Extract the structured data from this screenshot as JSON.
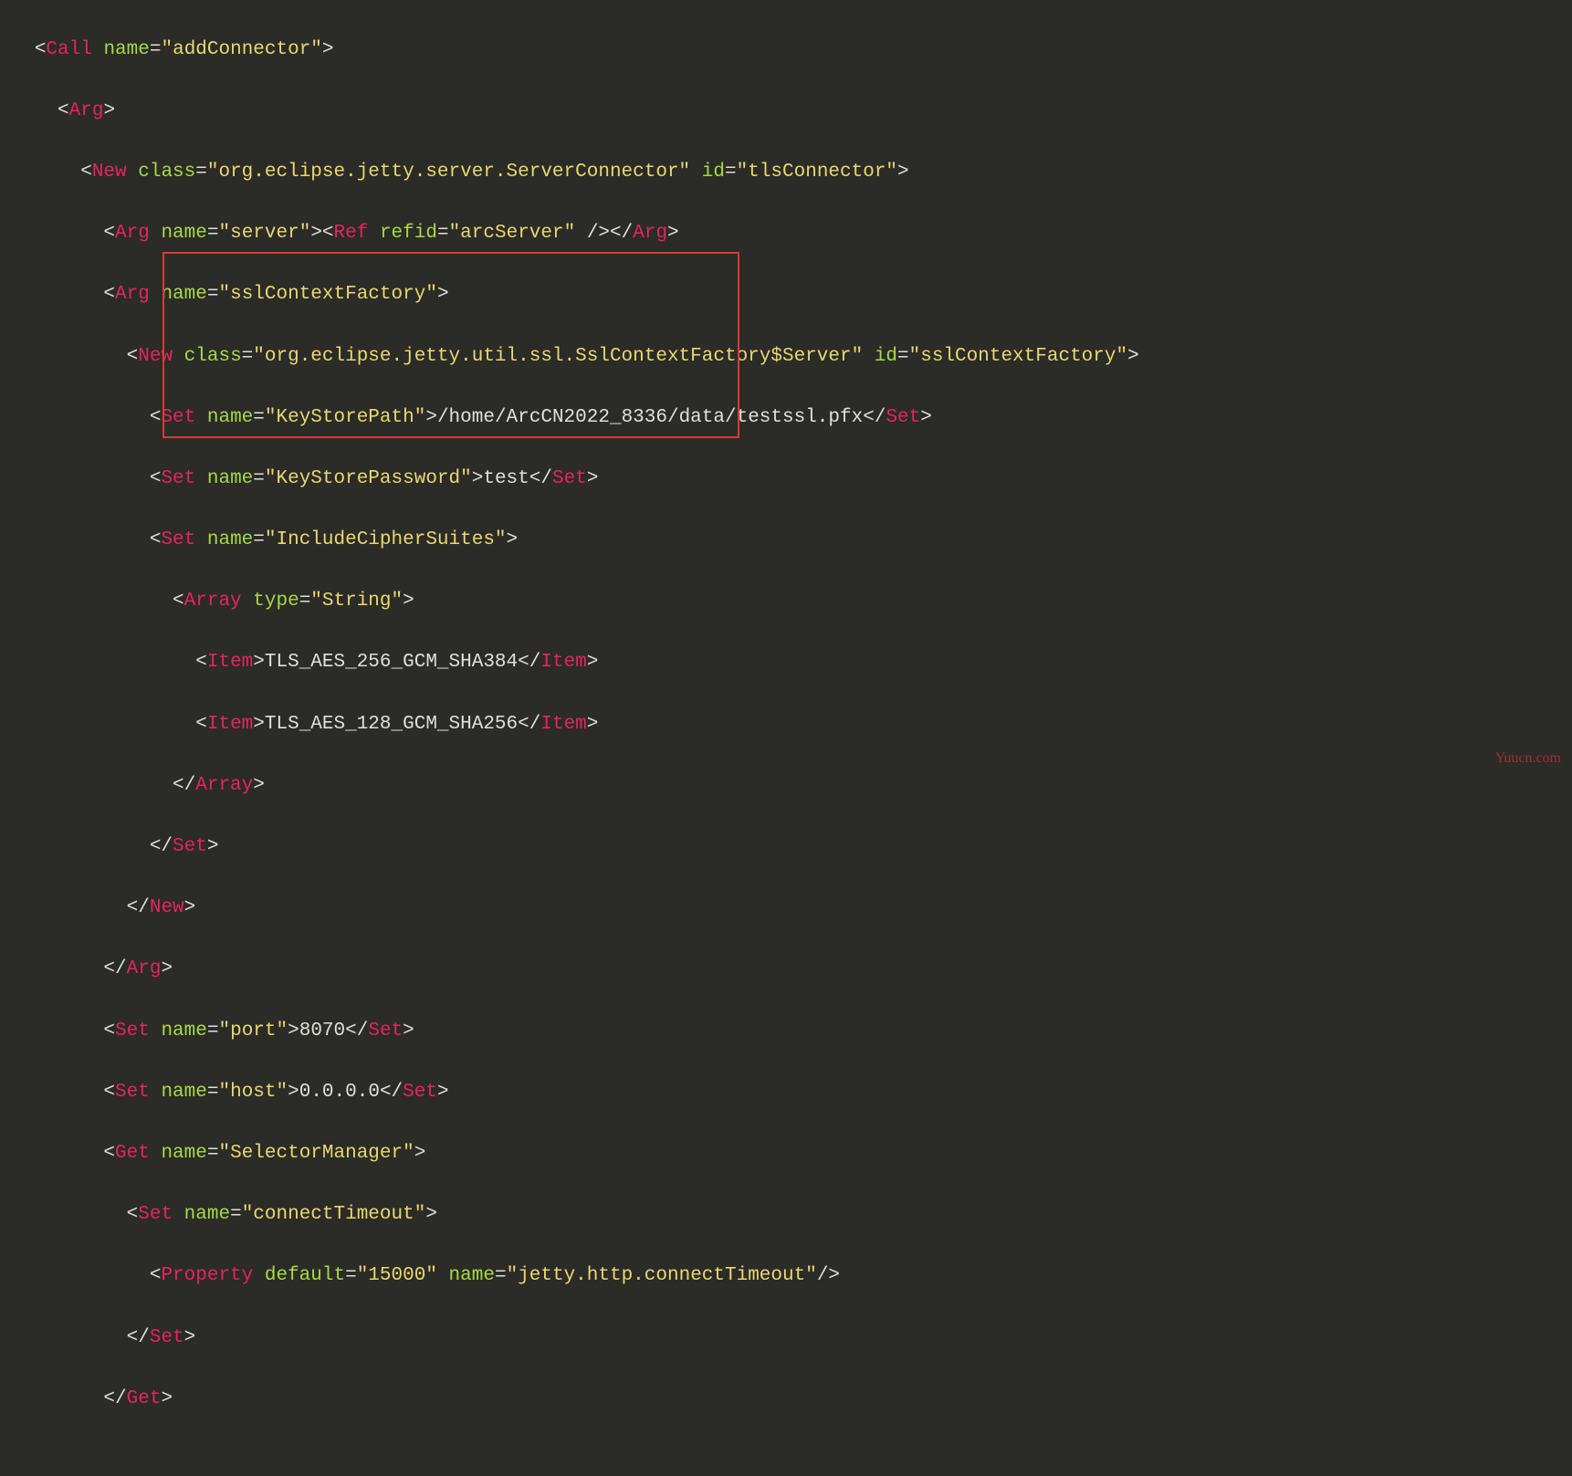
{
  "lines": {
    "l1_tag": "Call",
    "l1_attr": "name",
    "l1_val": "\"addConnector\"",
    "l2_tag": "Arg",
    "l3_tag": "New",
    "l3_a1": "class",
    "l3_v1": "\"org.eclipse.jetty.server.ServerConnector\"",
    "l3_a2": "id",
    "l3_v2": "\"tlsConnector\"",
    "l4_tag1": "Arg",
    "l4_a1": "name",
    "l4_v1": "\"server\"",
    "l4_tag2": "Ref",
    "l4_a2": "refid",
    "l4_v2": "\"arcServer\"",
    "l4_close": "Arg",
    "l5_tag": "Arg",
    "l5_a": "name",
    "l5_v": "\"sslContextFactory\"",
    "l6_tag": "New",
    "l6_a1": "class",
    "l6_v1": "\"org.eclipse.jetty.util.ssl.SslContextFactory$Server\"",
    "l6_a2": "id",
    "l6_v2": "\"sslContextFactory\"",
    "l7_tag": "Set",
    "l7_a": "name",
    "l7_v": "\"KeyStorePath\"",
    "l7_text": "/home/ArcCN2022_8336/data/testssl.pfx",
    "l7_close": "Set",
    "l8_tag": "Set",
    "l8_a": "name",
    "l8_v": "\"KeyStorePassword\"",
    "l8_text": "test",
    "l8_close": "Set",
    "l9_tag": "Set",
    "l9_a": "name",
    "l9_v": "\"IncludeCipherSuites\"",
    "l10_tag": "Array",
    "l10_a": "type",
    "l10_v": "\"String\"",
    "l11_tag": "Item",
    "l11_text": "TLS_AES_256_GCM_SHA384",
    "l11_close": "Item",
    "l12_tag": "Item",
    "l12_text": "TLS_AES_128_GCM_SHA256",
    "l12_close": "Item",
    "l13_close": "Array",
    "l14_close": "Set",
    "l15_close": "New",
    "l16_close": "Arg",
    "l17_tag": "Set",
    "l17_a": "name",
    "l17_v": "\"port\"",
    "l17_text": "8070",
    "l17_close": "Set",
    "l18_tag": "Set",
    "l18_a": "name",
    "l18_v": "\"host\"",
    "l18_text": "0.0.0.0",
    "l18_close": "Set",
    "l19_tag": "Get",
    "l19_a": "name",
    "l19_v": "\"SelectorManager\"",
    "l20_tag": "Set",
    "l20_a": "name",
    "l20_v": "\"connectTimeout\"",
    "l21_tag": "Property",
    "l21_a1": "default",
    "l21_v1": "\"15000\"",
    "l21_a2": "name",
    "l21_v2": "\"jetty.http.connectTimeout\"",
    "l22_close": "Set",
    "l23_close": "Get"
  },
  "watermark": "Yuucn.com"
}
